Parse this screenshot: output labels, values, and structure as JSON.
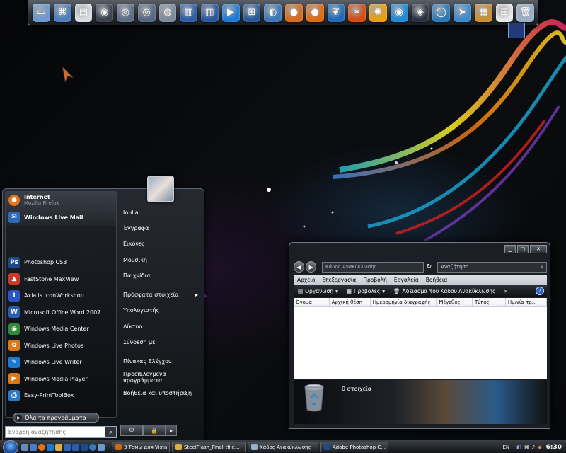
{
  "dock": {
    "icons": [
      {
        "name": "computer-icon",
        "color": "#6a9ad0",
        "glyph": "▭"
      },
      {
        "name": "network-icon",
        "color": "#4a7fc0",
        "glyph": "⌘"
      },
      {
        "name": "document-icon",
        "color": "#d8dde5",
        "glyph": "▤"
      },
      {
        "name": "camera-icon",
        "color": "#3b4350",
        "glyph": "◉"
      },
      {
        "name": "disk-tools-icon",
        "color": "#5c6e88",
        "glyph": "◎"
      },
      {
        "name": "disk-tools-2-icon",
        "color": "#546882",
        "glyph": "◎"
      },
      {
        "name": "drive-icon",
        "color": "#7c8c9c",
        "glyph": "◍"
      },
      {
        "name": "books-icon",
        "color": "#2c5ea8",
        "glyph": "▥"
      },
      {
        "name": "books-2-icon",
        "color": "#2a58a0",
        "glyph": "▥"
      },
      {
        "name": "media-player-icon",
        "color": "#1b7ad8",
        "glyph": "▶"
      },
      {
        "name": "windows-icon",
        "color": "#2a5a9a",
        "glyph": "⊞"
      },
      {
        "name": "globe-icon",
        "color": "#3a78b8",
        "glyph": "◐"
      },
      {
        "name": "firefox-icon",
        "color": "#d86a1a",
        "glyph": "●"
      },
      {
        "name": "orange-app-icon",
        "color": "#e06a10",
        "glyph": "●"
      },
      {
        "name": "leaf-icon",
        "color": "#1e6ab8",
        "glyph": "❦"
      },
      {
        "name": "butterfly-icon",
        "color": "#d84a10",
        "glyph": "✶"
      },
      {
        "name": "sun-icon",
        "color": "#e8a010",
        "glyph": "✺"
      },
      {
        "name": "eye-icon",
        "color": "#1e8ad8",
        "glyph": "◉"
      },
      {
        "name": "photo-icon",
        "color": "#2a3040",
        "glyph": "◈"
      },
      {
        "name": "ring-icon",
        "color": "#2a7ab8",
        "glyph": "◯"
      },
      {
        "name": "arrow-icon",
        "color": "#3a8ad0",
        "glyph": "➤"
      },
      {
        "name": "library-icon",
        "color": "#c89030",
        "glyph": "▦"
      },
      {
        "name": "windows-flag-icon",
        "color": "#e8e8e8",
        "glyph": "⊞"
      },
      {
        "name": "recycle-bin-icon",
        "color": "#9ab0c8",
        "glyph": "🗑"
      }
    ]
  },
  "start_menu": {
    "pinned": [
      {
        "title": "Internet",
        "subtitle": "Mozilla Firefox",
        "icon": "firefox-icon",
        "color": "#e8731a"
      },
      {
        "title": "Windows Live Mail",
        "icon": "mail-icon",
        "color": "#2a6ab8"
      }
    ],
    "recent": [
      {
        "label": "Photoshop CS3",
        "icon": "photoshop-icon",
        "color": "#1c4a8a",
        "glyph": "Ps"
      },
      {
        "label": "FastStone MaxView",
        "icon": "faststone-icon",
        "color": "#c83a2a",
        "glyph": "▲"
      },
      {
        "label": "Axialis IconWorkshop",
        "icon": "axialis-icon",
        "color": "#2a56c8",
        "glyph": "I"
      },
      {
        "label": "Microsoft Office Word 2007",
        "icon": "word-icon",
        "color": "#2b5cb0",
        "glyph": "W"
      },
      {
        "label": "Windows Media Center",
        "icon": "media-center-icon",
        "color": "#2e8a3a",
        "glyph": "◉"
      },
      {
        "label": "Windows Live Photos",
        "icon": "live-photos-icon",
        "color": "#d87a1a",
        "glyph": "✿"
      },
      {
        "label": "Windows Live Writer",
        "icon": "live-writer-icon",
        "color": "#1a7ad0",
        "glyph": "✎"
      },
      {
        "label": "Windows Media Player",
        "icon": "media-player-icon",
        "color": "#d8781a",
        "glyph": "▶"
      },
      {
        "label": "Easy-PrintToolBox",
        "icon": "print-icon",
        "color": "#2a7ac8",
        "glyph": "⎙"
      }
    ],
    "all_programs": "Όλα τα προγράμματα",
    "search_placeholder": "Έναρξη αναζήτησης",
    "right": [
      "Ioulia",
      "Έγγραφα",
      "Εικόνες",
      "Μουσική",
      "Παιχνίδια",
      "Πρόσφατα στοιχεία",
      "Υπολογιστής",
      "Δίκτυο",
      "Σύνδεση με",
      "Πίνακας Ελέγχου",
      "Προεπιλεγμένα προγράμματα",
      "Βοήθεια και υποστήριξη"
    ],
    "recent_items_arrow": "▸"
  },
  "explorer": {
    "address": "Κάδος Ανακύκλωσης",
    "search_placeholder": "Αναζήτηση",
    "menu": [
      "Αρχείο",
      "Επεξεργασία",
      "Προβολή",
      "Εργαλεία",
      "Βοήθεια"
    ],
    "toolbar": {
      "organize": "Οργάνωση",
      "views": "Προβολές",
      "empty": "Άδειασμα του Κάδου Ανακύκλωσης",
      "more": "»"
    },
    "columns": [
      "Όνομα",
      "Αρχική θέση",
      "Ημερομηνία διαγραφής",
      "Μέγεθος",
      "Τύπος",
      "Ημ/νία τρ..."
    ],
    "status": "0 στοιχεία"
  },
  "taskbar": {
    "tasks": [
      {
        "label": "3 Темы для Vista! В...",
        "color": "#c86a1a"
      },
      {
        "label": "SteelFlash_Final[tfile...",
        "color": "#d8b040"
      },
      {
        "label": "Κάδος Ανακύκλωσης",
        "color": "#9ab0c8"
      },
      {
        "label": "Adobe Photoshop C...",
        "color": "#1c4a8a"
      }
    ],
    "language": "EN",
    "clock": "6:30"
  }
}
